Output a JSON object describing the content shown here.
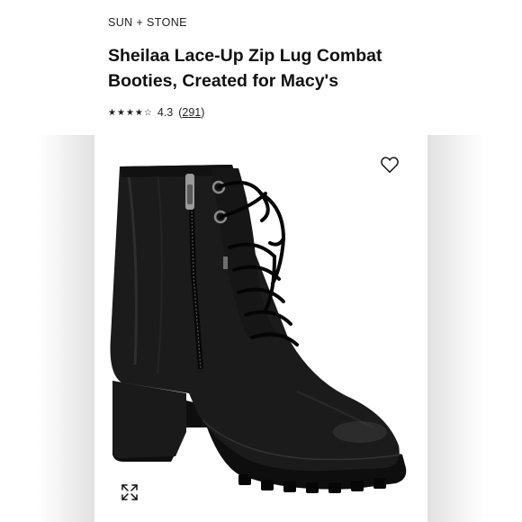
{
  "brand": "SUN + STONE",
  "product": {
    "title": "Sheilaa Lace-Up Zip Lug Combat Booties, Created for Macy's"
  },
  "rating": {
    "value": "4.3",
    "reviews_count": "291",
    "stars": 4.3,
    "stars_max": 5
  },
  "icons": {
    "favorite": "heart-outline-icon",
    "expand": "expand-arrows-icon"
  },
  "image": {
    "subject": "black lace-up combat boot"
  },
  "colors": {
    "text": "#111111",
    "boot": "#161616"
  }
}
